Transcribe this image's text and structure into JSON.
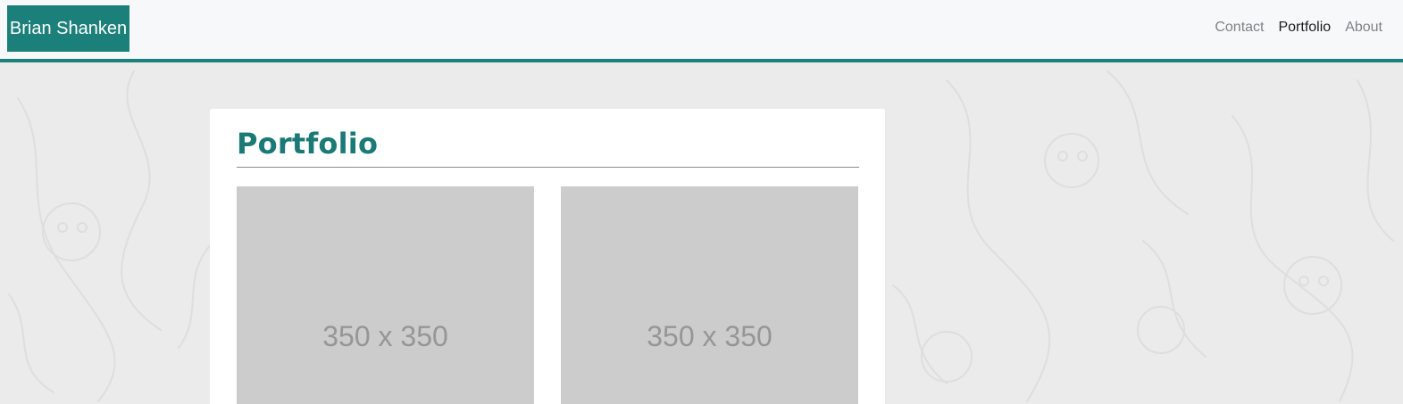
{
  "header": {
    "brand": "Brian Shanken",
    "nav": [
      {
        "label": "Contact",
        "active": false
      },
      {
        "label": "Portfolio",
        "active": true
      },
      {
        "label": "About",
        "active": false
      }
    ]
  },
  "main": {
    "title": "Portfolio",
    "placeholders": [
      {
        "label": "350 x 350"
      },
      {
        "label": "350 x 350"
      }
    ]
  },
  "colors": {
    "accent": "#1b7f7a",
    "page_background": "#ebebeb",
    "placeholder": "#cccccc"
  }
}
